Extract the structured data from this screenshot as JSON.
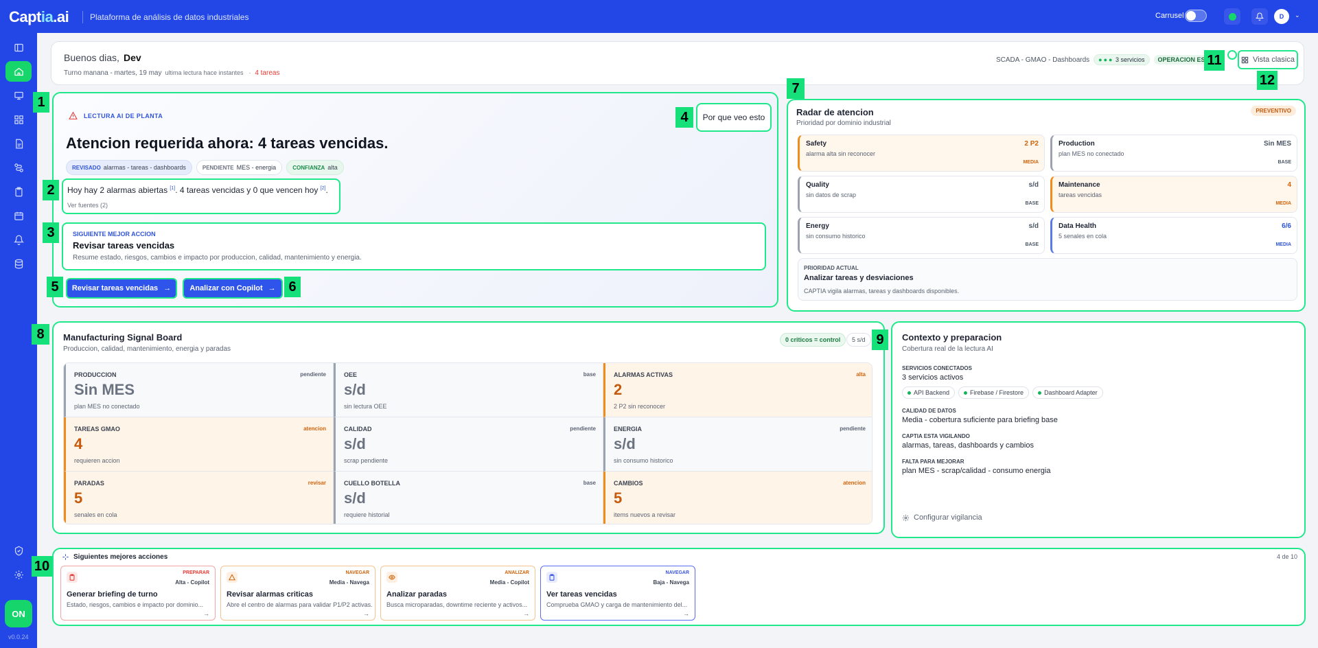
{
  "topbar": {
    "logo_a": "Capt",
    "logo_b": "ia",
    "logo_c": ".ai",
    "subtitle": "Plataforma de análisis de datos industriales",
    "carousel_label": "Carrusel",
    "user_initial": "D"
  },
  "sidebar": {
    "on_label": "ON",
    "version": "v0.0.24"
  },
  "greeting": {
    "hello": "Buenos dias,",
    "name": "Dev",
    "shift": "Turno manana - martes, 19 may",
    "last_read": "ultima lectura hace instantes",
    "sep": "·",
    "tasks": "4 tareas",
    "services_path": "SCADA - GMAO - Dashboards",
    "services_count": "3 servicios",
    "operation": "OPERACION ESTA",
    "classic_view": "Vista clasica"
  },
  "lectura": {
    "tag": "LECTURA AI DE PLANTA",
    "why": "Por que veo esto",
    "title": "Atencion requerida ahora: 4 tareas vencidas.",
    "chips": [
      {
        "k": "REVISADO",
        "v": "alarmas - tareas - dashboards"
      },
      {
        "k": "PENDIENTE",
        "v": "MES - energia"
      },
      {
        "k": "CONFIANZA",
        "v": "alta"
      }
    ],
    "summary_a": "Hoy hay 2 alarmas abiertas",
    "ref1": "[1]",
    "summary_b": ". 4 tareas vencidas y 0 que vencen hoy",
    "ref2": "[2]",
    "summary_c": ".",
    "sources": "Ver fuentes (2)",
    "next_label": "SIGUIENTE MEJOR ACCION",
    "next_title": "Revisar tareas vencidas",
    "next_desc": "Resume estado, riesgos, cambios e impacto por produccion, calidad, mantenimiento y energia.",
    "btn_review": "Revisar tareas vencidas",
    "btn_copilot": "Analizar con Copilot"
  },
  "radar": {
    "title": "Radar de atencion",
    "subtitle": "Prioridad por dominio industrial",
    "badge": "PREVENTIVO",
    "tiles": [
      {
        "name": "Safety",
        "desc": "alarma alta sin reconocer",
        "val": "2 P2",
        "lvl": "MEDIA"
      },
      {
        "name": "Production",
        "desc": "plan MES no conectado",
        "val": "Sin MES",
        "lvl": "BASE"
      },
      {
        "name": "Quality",
        "desc": "sin datos de scrap",
        "val": "s/d",
        "lvl": "BASE"
      },
      {
        "name": "Maintenance",
        "desc": "tareas vencidas",
        "val": "4",
        "lvl": "MEDIA"
      },
      {
        "name": "Energy",
        "desc": "sin consumo historico",
        "val": "s/d",
        "lvl": "BASE"
      },
      {
        "name": "Data Health",
        "desc": "5 senales en cola",
        "val": "6/6",
        "lvl": "MEDIA"
      }
    ],
    "prio_label": "PRIORIDAD ACTUAL",
    "prio_title": "Analizar tareas y desviaciones",
    "prio_desc": "CAPTIA vigila alarmas, tareas y dashboards disponibles."
  },
  "board": {
    "title": "Manufacturing Signal Board",
    "subtitle": "Produccion, calidad, mantenimiento, energia y paradas",
    "critical": "0 criticos = control",
    "nodata": "5 s/d",
    "cells": [
      {
        "name": "PRODUCCION",
        "state": "pendiente",
        "val": "Sin MES",
        "desc": "plan MES no conectado"
      },
      {
        "name": "OEE",
        "state": "base",
        "val": "s/d",
        "desc": "sin lectura OEE"
      },
      {
        "name": "ALARMAS ACTIVAS",
        "state": "alta",
        "val": "2",
        "desc": "2 P2 sin reconocer"
      },
      {
        "name": "TAREAS GMAO",
        "state": "atencion",
        "val": "4",
        "desc": "requieren accion"
      },
      {
        "name": "CALIDAD",
        "state": "pendiente",
        "val": "s/d",
        "desc": "scrap pendiente"
      },
      {
        "name": "ENERGIA",
        "state": "pendiente",
        "val": "s/d",
        "desc": "sin consumo historico"
      },
      {
        "name": "PARADAS",
        "state": "revisar",
        "val": "5",
        "desc": "senales en cola"
      },
      {
        "name": "CUELLO BOTELLA",
        "state": "base",
        "val": "s/d",
        "desc": "requiere historial"
      },
      {
        "name": "CAMBIOS",
        "state": "atencion",
        "val": "5",
        "desc": "items nuevos a revisar"
      }
    ]
  },
  "context": {
    "title": "Contexto y preparacion",
    "subtitle": "Cobertura real de la lectura AI",
    "services_label": "SERVICIOS CONECTADOS",
    "services_val": "3 servicios activos",
    "services": [
      "API Backend",
      "Firebase / Firestore",
      "Dashboard Adapter"
    ],
    "quality_label": "CALIDAD DE DATOS",
    "quality_val": "Media - cobertura suficiente para briefing base",
    "watch_label": "CAPTIA ESTA VIGILANDO",
    "watch_val": "alarmas, tareas, dashboards y cambios",
    "missing_label": "FALTA PARA MEJORAR",
    "missing_val": "plan MES - scrap/calidad - consumo energia",
    "configure": "Configurar vigilancia"
  },
  "actions": {
    "title": "Siguientes mejores acciones",
    "count": "4 de 10",
    "items": [
      {
        "kind": "PREPARAR",
        "meta": "Alta - Copilot",
        "title": "Generar briefing de turno",
        "desc": "Estado, riesgos, cambios e impacto por dominio..."
      },
      {
        "kind": "NAVEGAR",
        "meta": "Media - Navega",
        "title": "Revisar alarmas criticas",
        "desc": "Abre el centro de alarmas para validar P1/P2 activas."
      },
      {
        "kind": "ANALIZAR",
        "meta": "Media - Copilot",
        "title": "Analizar paradas",
        "desc": "Busca microparadas, downtime reciente y activos..."
      },
      {
        "kind": "NAVEGAR",
        "meta": "Baja - Navega",
        "title": "Ver tareas vencidas",
        "desc": "Comprueba GMAO y carga de mantenimiento del..."
      }
    ]
  },
  "markers": [
    "1",
    "2",
    "3",
    "4",
    "5",
    "6",
    "7",
    "8",
    "9",
    "10",
    "11",
    "12"
  ],
  "colors": {
    "brand": "#2247e6",
    "accent": "#16d56a",
    "warn": "#f08c1a",
    "danger": "#e53935"
  }
}
